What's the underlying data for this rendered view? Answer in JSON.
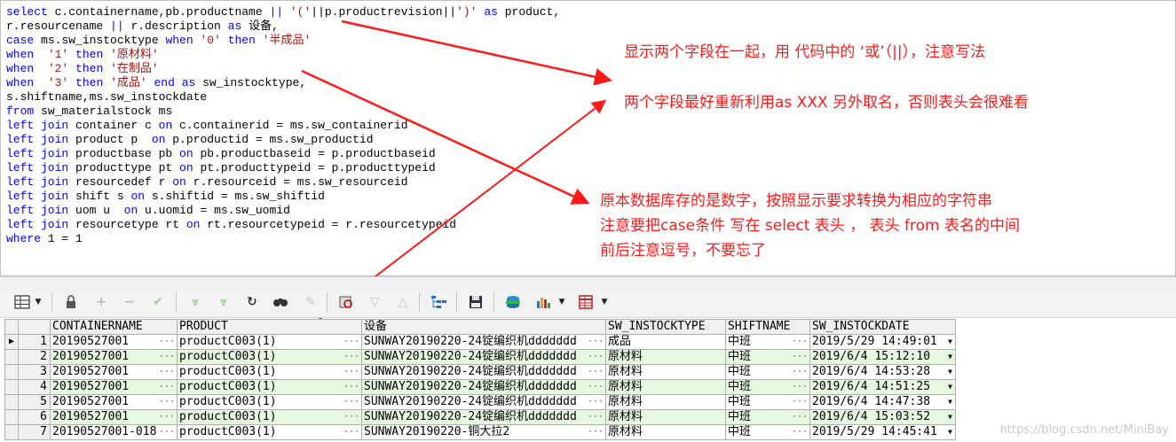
{
  "sql_lines": [
    [
      [
        "k",
        "select "
      ],
      [
        "t",
        "c.containername,pb.productname "
      ],
      [
        "k",
        "||"
      ],
      [
        "t",
        " "
      ],
      [
        "s",
        "'('"
      ],
      [
        "t",
        "||p.productrevision||"
      ],
      [
        "s",
        "')'"
      ],
      [
        "t",
        " "
      ],
      [
        "k",
        "as"
      ],
      [
        "t",
        " product,"
      ]
    ],
    [
      [
        "t",
        "r.resourcename "
      ],
      [
        "k",
        "||"
      ],
      [
        "t",
        " r.description "
      ],
      [
        "k",
        "as"
      ],
      [
        "t",
        " 设备,"
      ]
    ],
    [
      [
        "k",
        "case"
      ],
      [
        "t",
        " ms.sw_instocktype "
      ],
      [
        "k",
        "when"
      ],
      [
        "t",
        " "
      ],
      [
        "s",
        "'0'"
      ],
      [
        "t",
        " "
      ],
      [
        "k",
        "then"
      ],
      [
        "t",
        " "
      ],
      [
        "s",
        "'半成品'"
      ]
    ],
    [
      [
        "k",
        "when"
      ],
      [
        "t",
        "  "
      ],
      [
        "s",
        "'1'"
      ],
      [
        "t",
        " "
      ],
      [
        "k",
        "then"
      ],
      [
        "t",
        " "
      ],
      [
        "s",
        "'原材料'"
      ]
    ],
    [
      [
        "k",
        "when"
      ],
      [
        "t",
        "  "
      ],
      [
        "s",
        "'2'"
      ],
      [
        "t",
        " "
      ],
      [
        "k",
        "then"
      ],
      [
        "t",
        " "
      ],
      [
        "s",
        "'在制品'"
      ]
    ],
    [
      [
        "k",
        "when"
      ],
      [
        "t",
        "  "
      ],
      [
        "s",
        "'3'"
      ],
      [
        "t",
        " "
      ],
      [
        "k",
        "then"
      ],
      [
        "t",
        " "
      ],
      [
        "s",
        "'成品'"
      ],
      [
        "t",
        " "
      ],
      [
        "k",
        "end as"
      ],
      [
        "t",
        " sw_instocktype,"
      ]
    ],
    [
      [
        "t",
        "s.shiftname,ms.sw_instockdate"
      ]
    ],
    [
      [
        "k",
        "from"
      ],
      [
        "t",
        " sw_materialstock ms"
      ]
    ],
    [
      [
        "k",
        "left join"
      ],
      [
        "t",
        " container c "
      ],
      [
        "k",
        "on"
      ],
      [
        "t",
        " c.containerid = ms.sw_containerid"
      ]
    ],
    [
      [
        "k",
        "left join"
      ],
      [
        "t",
        " product p  "
      ],
      [
        "k",
        "on"
      ],
      [
        "t",
        " p.productid = ms.sw_productid"
      ]
    ],
    [
      [
        "k",
        "left join"
      ],
      [
        "t",
        " productbase pb "
      ],
      [
        "k",
        "on"
      ],
      [
        "t",
        " pb.productbaseid = p.productbaseid"
      ]
    ],
    [
      [
        "k",
        "left join"
      ],
      [
        "t",
        " producttype pt "
      ],
      [
        "k",
        "on"
      ],
      [
        "t",
        " pt.producttypeid = p.producttypeid"
      ]
    ],
    [
      [
        "k",
        "left join"
      ],
      [
        "t",
        " resourcedef r "
      ],
      [
        "k",
        "on"
      ],
      [
        "t",
        " r.resourceid = ms.sw_resourceid"
      ]
    ],
    [
      [
        "k",
        "left join"
      ],
      [
        "t",
        " shift s "
      ],
      [
        "k",
        "on"
      ],
      [
        "t",
        " s.shiftid = ms.sw_shiftid"
      ]
    ],
    [
      [
        "k",
        "left join"
      ],
      [
        "t",
        " uom u  "
      ],
      [
        "k",
        "on"
      ],
      [
        "t",
        " u.uomid = ms.sw_uomid"
      ]
    ],
    [
      [
        "k",
        "left join"
      ],
      [
        "t",
        " resourcetype rt "
      ],
      [
        "k",
        "on"
      ],
      [
        "t",
        " rt.resourcetypeid = r.resourcetypeid"
      ]
    ],
    [
      [
        "k",
        "where"
      ],
      [
        "t",
        " 1 = 1"
      ]
    ]
  ],
  "annotations": {
    "note1": "显示两个字段在一起，用 代码中的 ‘或’（||），注意写法",
    "note2": "两个字段最好重新利用as XXX 另外取名，否则表头会很难看",
    "note3_line1": "原本数据库存的是数字，按照显示要求转换为相应的字符串",
    "note3_line2": "注意要把case条件 写在 select 表头 ， 表头 from 表名的中间",
    "note3_line3": "前后注意逗号，不要忘了"
  },
  "annotation_color": "#ff1a1a",
  "toolbar_icons": [
    "grid-view-icon",
    "lock-icon",
    "add-record-icon",
    "delete-record-icon",
    "post-changes-icon",
    "fetch-next-icon",
    "fetch-last-icon",
    "refresh-icon",
    "find-icon",
    "clear-icon",
    "query-by-example-icon",
    "next-record-icon",
    "previous-record-icon",
    "explain-plan-icon",
    "save-icon",
    "export-icon",
    "chart-icon",
    "table-icon"
  ],
  "grid": {
    "columns": [
      "CONTAINERNAME",
      "PRODUCT",
      "设备",
      "SW_INSTOCKTYPE",
      "SHIFTNAME",
      "SW_INSTOCKDATE"
    ],
    "rows": [
      {
        "num": "1",
        "containername": "20190527001",
        "product": "productC003(1)",
        "device": "SUNWAY20190220-24锭编织机ddddddd",
        "type": "成品",
        "shift": "中班",
        "date": "2019/5/29 14:49:01"
      },
      {
        "num": "2",
        "containername": "20190527001",
        "product": "productC003(1)",
        "device": "SUNWAY20190220-24锭编织机ddddddd",
        "type": "原材料",
        "shift": "中班",
        "date": "2019/6/4 15:12:10"
      },
      {
        "num": "3",
        "containername": "20190527001",
        "product": "productC003(1)",
        "device": "SUNWAY20190220-24锭编织机ddddddd",
        "type": "原材料",
        "shift": "中班",
        "date": "2019/6/4 14:53:28"
      },
      {
        "num": "4",
        "containername": "20190527001",
        "product": "productC003(1)",
        "device": "SUNWAY20190220-24锭编织机ddddddd",
        "type": "原材料",
        "shift": "中班",
        "date": "2019/6/4 14:51:25"
      },
      {
        "num": "5",
        "containername": "20190527001",
        "product": "productC003(1)",
        "device": "SUNWAY20190220-24锭编织机ddddddd",
        "type": "原材料",
        "shift": "中班",
        "date": "2019/6/4 14:47:38"
      },
      {
        "num": "6",
        "containername": "20190527001",
        "product": "productC003(1)",
        "device": "SUNWAY20190220-24锭编织机ddddddd",
        "type": "原材料",
        "shift": "中班",
        "date": "2019/6/4 15:03:52"
      },
      {
        "num": "7",
        "containername": "20190527001-018",
        "product": "productC003(1)",
        "device": "SUNWAY20190220-铜大拉2",
        "type": "原材料",
        "shift": "中班",
        "date": "2019/5/29 14:45:41"
      }
    ]
  },
  "watermark": "https://blog.csdn.net/MiniBay"
}
